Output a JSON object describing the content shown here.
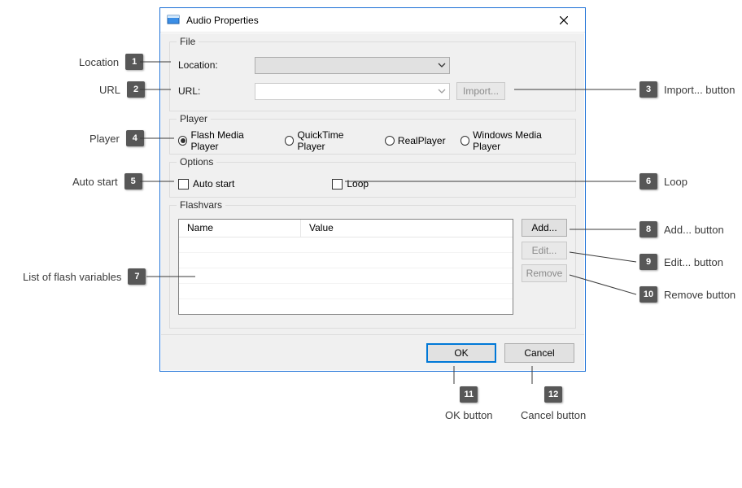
{
  "window": {
    "title": "Audio Properties"
  },
  "file_group": {
    "legend": "File",
    "location_label": "Location:",
    "location_value": "",
    "url_label": "URL:",
    "url_value": "",
    "import_label": "Import..."
  },
  "player_group": {
    "legend": "Player",
    "options": [
      {
        "label": "Flash Media Player",
        "selected": true
      },
      {
        "label": "QuickTime Player",
        "selected": false
      },
      {
        "label": "RealPlayer",
        "selected": false
      },
      {
        "label": "Windows Media Player",
        "selected": false
      }
    ]
  },
  "options_group": {
    "legend": "Options",
    "autostart_label": "Auto start",
    "autostart_checked": false,
    "loop_label": "Loop",
    "loop_checked": false
  },
  "flashvars_group": {
    "legend": "Flashvars",
    "col_name": "Name",
    "col_value": "Value",
    "rows": [],
    "add_label": "Add...",
    "edit_label": "Edit...",
    "remove_label": "Remove"
  },
  "buttons": {
    "ok": "OK",
    "cancel": "Cancel"
  },
  "callouts": {
    "c1": "Location",
    "c2": "URL",
    "c3": "Import... button",
    "c4": "Player",
    "c5": "Auto start",
    "c6": "Loop",
    "c7": "List of flash variables",
    "c8": "Add... button",
    "c9": "Edit... button",
    "c10": "Remove button",
    "c11": "OK button",
    "c12": "Cancel button"
  }
}
